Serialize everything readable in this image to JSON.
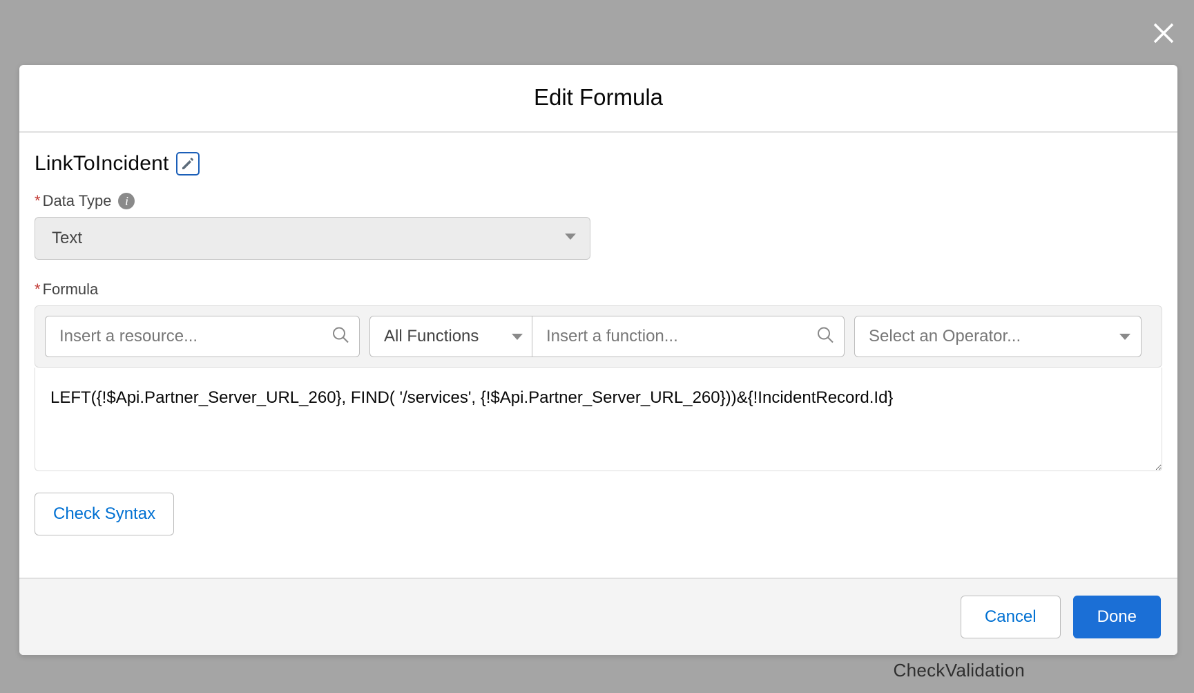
{
  "background": {
    "visible_text": "CheckValidation"
  },
  "modal": {
    "title": "Edit Formula",
    "name": "LinkToIncident",
    "data_type": {
      "label": "Data Type",
      "value": "Text"
    },
    "formula": {
      "label": "Formula",
      "resource_placeholder": "Insert a resource...",
      "functions_category": "All Functions",
      "function_placeholder": "Insert a function...",
      "operator_placeholder": "Select an Operator...",
      "value": "LEFT({!$Api.Partner_Server_URL_260}, FIND( '/services', {!$Api.Partner_Server_URL_260}))&{!IncidentRecord.Id}"
    },
    "buttons": {
      "check_syntax": "Check Syntax",
      "cancel": "Cancel",
      "done": "Done"
    }
  }
}
